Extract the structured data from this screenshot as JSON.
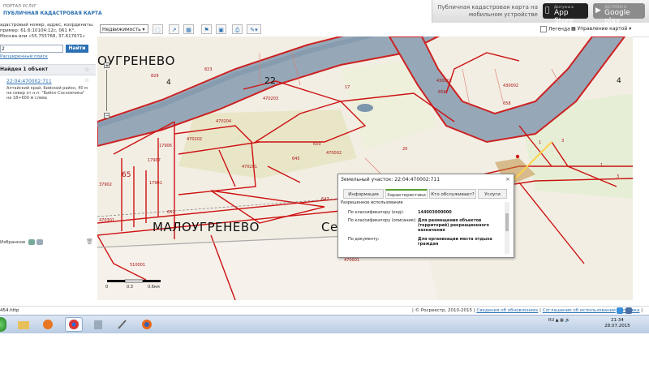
{
  "header": {
    "portal": "ПОРТАЛ УСЛУГ",
    "title": "ПУБЛИЧНАЯ КАДАСТРОВАЯ КАРТА",
    "promo_text": "Публичная кадастровая карта на мобильном устройстве",
    "appstore_small": "Доступно в",
    "appstore_big": "App Store",
    "googleplay_small": "ДОСТУПНО В",
    "googleplay_big": "Google play"
  },
  "sidebar": {
    "hint_line1": "адастровый номер, адрес, координаты.",
    "hint_line2": "пример: 61:6:10104:12с, 061 К°,",
    "hint_line3": "Москва или «55.755768, 37.617671»",
    "search_value": "2",
    "find_label": "Найти",
    "advanced_label": "Расширенный поиск",
    "found_label": "Найден 1 объект",
    "result_link": "22:04:470002:711",
    "result_desc": "Алтайский край, Бийский район, 40 м на север от н.п. \"Бийск-Сосновчика\" на 18+600 м слева",
    "favorites_label": "Избранное"
  },
  "toolbar": {
    "select_value": "Недвижимость",
    "legend_label": "Легенда",
    "layers_label": "Управление картой"
  },
  "map": {
    "town1": "ОУГРЕНЕВО",
    "town2": "МАЛОУГРЕНЕВО",
    "town3": "Се",
    "big_num": "22",
    "small_4a": "4",
    "small_4b": "4",
    "labels": [
      "470203",
      "470204",
      "470202",
      "470201",
      "470002",
      "430002",
      "430002",
      "470301",
      "470001",
      "510001",
      "17907",
      "65",
      "37902",
      "17901",
      "17906",
      "829",
      "823",
      "17",
      "658",
      "658",
      "650",
      "645",
      "20",
      "1",
      "3",
      "647",
      "645",
      "657",
      "1",
      "3"
    ]
  },
  "popup": {
    "title": "Земельный участок: 22:04:470002:711",
    "close": "×",
    "tabs": [
      "Информация",
      "Характеристики",
      "Кто обслуживает?",
      "Услуги"
    ],
    "section": "Разрешенное использование",
    "rows": [
      {
        "label": "По классификатору (код):",
        "value": "144003000000"
      },
      {
        "label": "По классификатору (описание):",
        "value": "Для размещения объектов (территорий) рекреационного назначения"
      },
      {
        "label": "По документу:",
        "value": "Для организации места отдыха граждан"
      }
    ]
  },
  "scale": {
    "t0": "0",
    "t1": "0.3",
    "t2": "0.6км"
  },
  "footer": {
    "left": "454.http",
    "copyright": "| © Росреестр, 2010-2015 |",
    "link1": "Сведения об обновлениях",
    "link2": "Соглашение об использовании",
    "link3": "Справка"
  },
  "taskbar": {
    "lang": "RU",
    "time": "21:34",
    "date": "28.07.2015"
  }
}
